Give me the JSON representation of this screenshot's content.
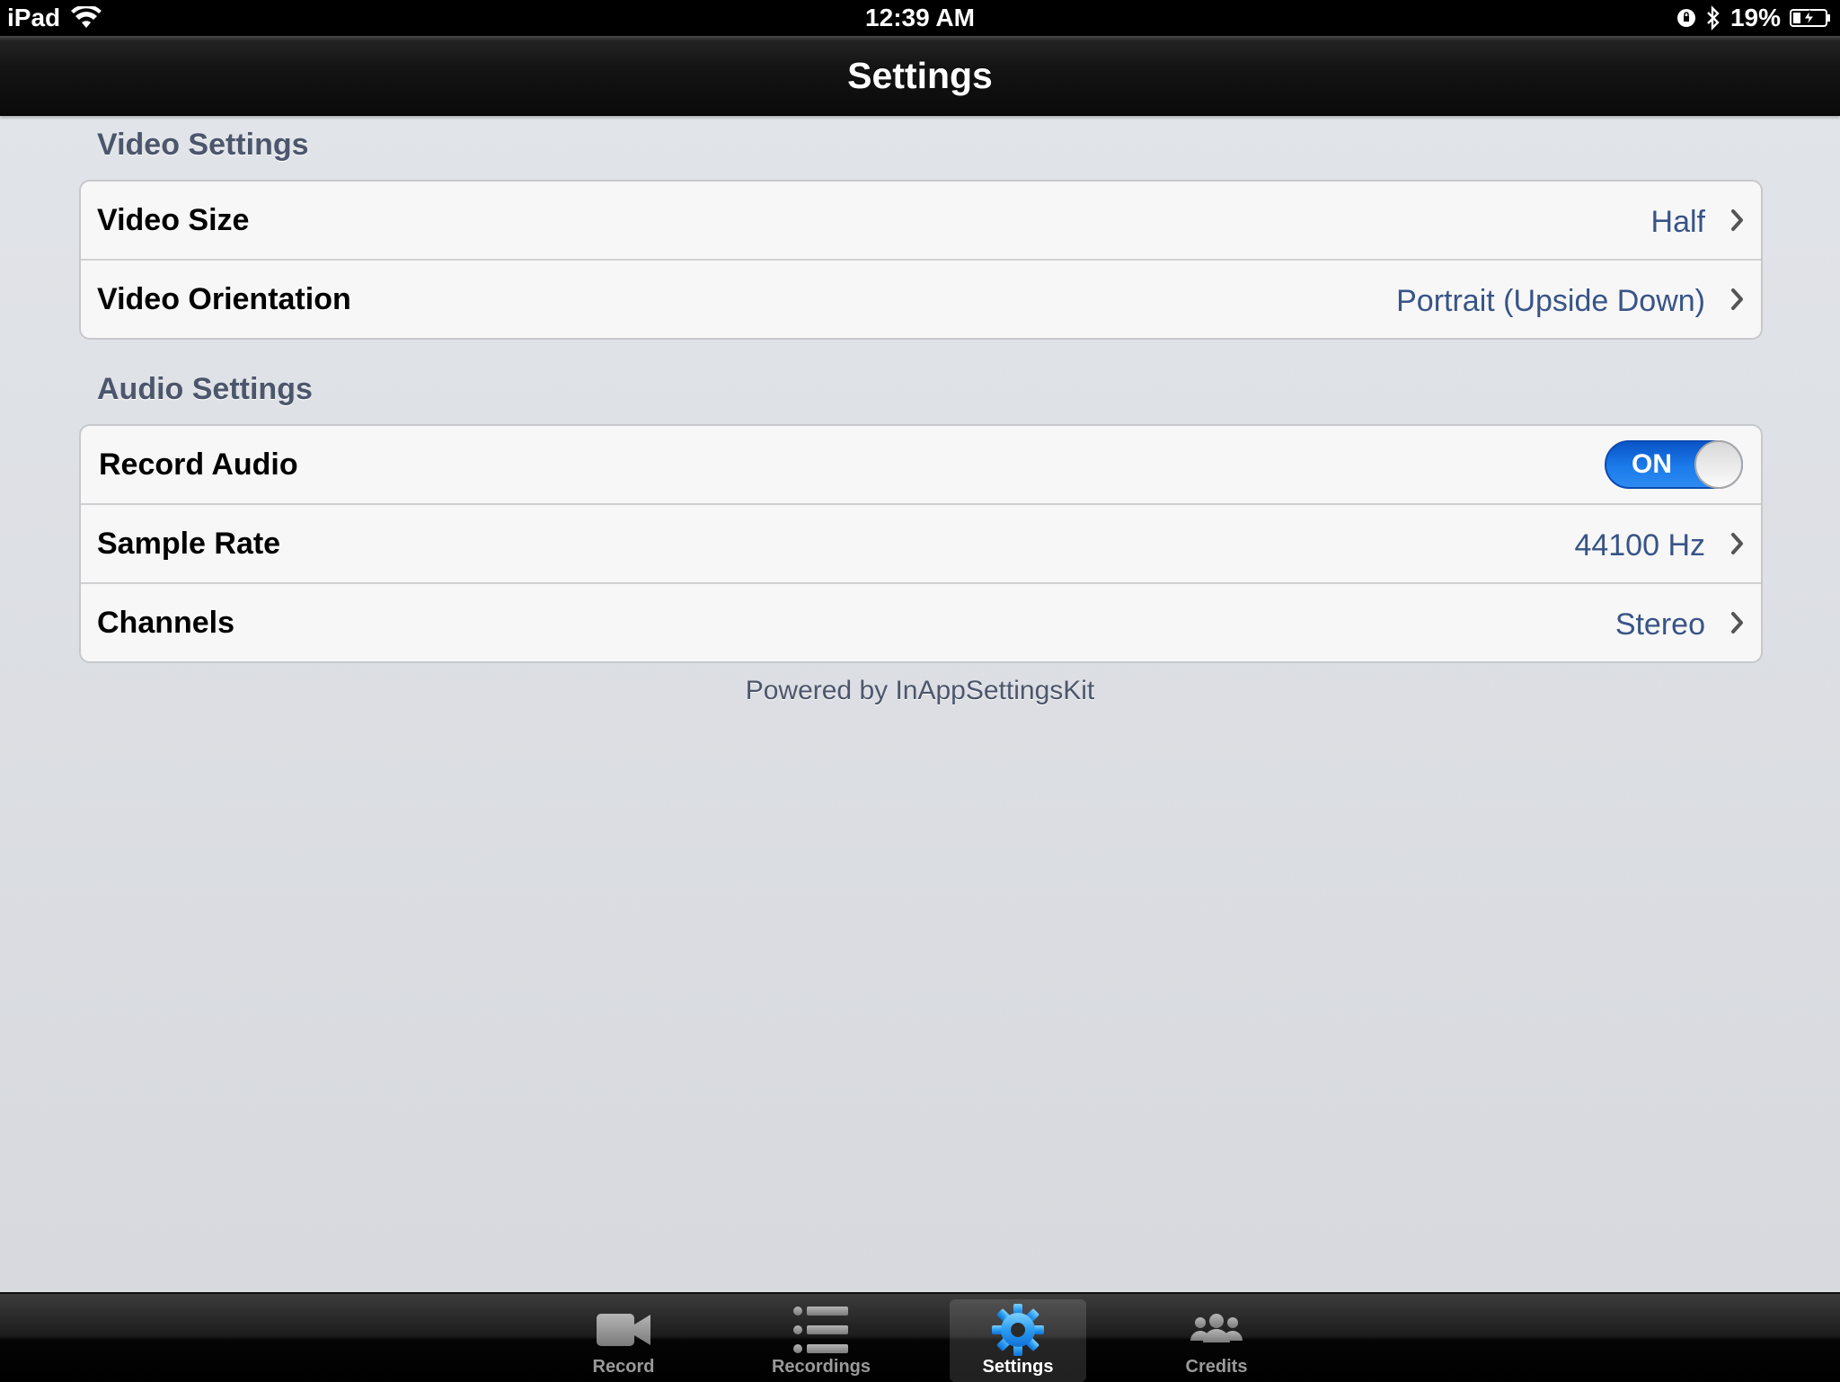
{
  "status_bar": {
    "device": "iPad",
    "time": "12:39 AM",
    "battery": "19%"
  },
  "nav": {
    "title": "Settings"
  },
  "sections": [
    {
      "header": "Video Settings",
      "rows": [
        {
          "label": "Video Size",
          "value": "Half"
        },
        {
          "label": "Video Orientation",
          "value": "Portrait (Upside Down)"
        }
      ]
    },
    {
      "header": "Audio Settings",
      "rows": [
        {
          "label": "Record Audio",
          "toggle": "ON"
        },
        {
          "label": "Sample Rate",
          "value": "44100 Hz"
        },
        {
          "label": "Channels",
          "value": "Stereo"
        }
      ]
    }
  ],
  "footer": "Powered by InAppSettingsKit",
  "tab_bar": {
    "tabs": [
      {
        "label": "Record",
        "icon": "video-camera-icon"
      },
      {
        "label": "Recordings",
        "icon": "list-icon"
      },
      {
        "label": "Settings",
        "icon": "gear-icon",
        "selected": true
      },
      {
        "label": "Credits",
        "icon": "people-icon"
      }
    ]
  },
  "colors": {
    "value_text": "#385487",
    "toggle_on": "#1b7bea",
    "section_header": "#4c566c"
  }
}
